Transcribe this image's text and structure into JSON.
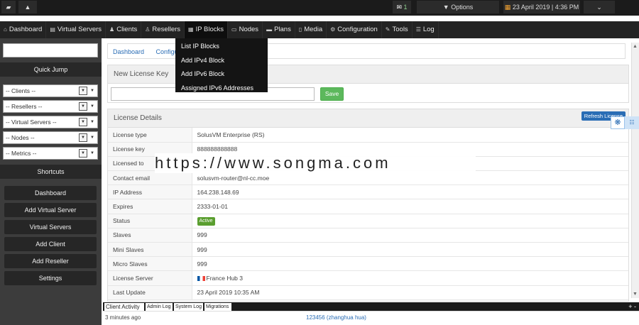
{
  "topbar": {
    "note_icon": "note-icon",
    "alert_icon": "warning-icon",
    "messages_count": "1",
    "options_label": "Options",
    "date_label": "23 April 2019 | 4:36 PM"
  },
  "nav": [
    {
      "label": "Dashboard",
      "icon": "home-icon",
      "glyph": "⌂"
    },
    {
      "label": "Virtual Servers",
      "icon": "server-icon",
      "glyph": "▤"
    },
    {
      "label": "Clients",
      "icon": "users-icon",
      "glyph": "♟"
    },
    {
      "label": "Resellers",
      "icon": "user-icon",
      "glyph": "♙"
    },
    {
      "label": "IP Blocks",
      "icon": "grid-icon",
      "glyph": "▦"
    },
    {
      "label": "Nodes",
      "icon": "node-icon",
      "glyph": "▭"
    },
    {
      "label": "Plans",
      "icon": "plans-icon",
      "glyph": "▬"
    },
    {
      "label": "Media",
      "icon": "media-icon",
      "glyph": "▯"
    },
    {
      "label": "Configuration",
      "icon": "gear-icon",
      "glyph": "⚙"
    },
    {
      "label": "Tools",
      "icon": "wrench-icon",
      "glyph": "✎"
    },
    {
      "label": "Log",
      "icon": "list-icon",
      "glyph": "☰"
    }
  ],
  "ip_dropdown": [
    "List IP Blocks",
    "Add IPv4 Block",
    "Add IPv6 Block",
    "Assigned IPv6 Addresses"
  ],
  "sidebar": {
    "quick_jump": "Quick Jump",
    "selects": [
      "-- Clients --",
      "-- Resellers --",
      "-- Virtual Servers --",
      "-- Nodes --",
      "-- Metrics --"
    ],
    "shortcuts_header": "Shortcuts",
    "shortcuts": [
      "Dashboard",
      "Add Virtual Server",
      "Virtual Servers",
      "Add Client",
      "Add Reseller",
      "Settings"
    ]
  },
  "breadcrumb": [
    "Dashboard",
    "Configu"
  ],
  "new_key": {
    "title": "New License Key",
    "save_label": "Save"
  },
  "details": {
    "title": "License Details",
    "refresh_label": "Refresh License",
    "rows": [
      {
        "key": "License type",
        "value": "SolusVM Enterprise (RS)"
      },
      {
        "key": "License key",
        "value": "888888888888"
      },
      {
        "key": "Licensed to",
        "value": ""
      },
      {
        "key": "Contact email",
        "value": "solusvm-router@nl-cc.moe"
      },
      {
        "key": "IP Address",
        "value": "164.238.148.69"
      },
      {
        "key": "Expires",
        "value": "2333-01-01"
      },
      {
        "key": "Status",
        "value": "Active"
      },
      {
        "key": "Slaves",
        "value": "999"
      },
      {
        "key": "Mini Slaves",
        "value": "999"
      },
      {
        "key": "Micro Slaves",
        "value": "999"
      },
      {
        "key": "License Server",
        "value": "France Hub 3"
      },
      {
        "key": "Last Update",
        "value": "23 April 2019 10:35 AM"
      }
    ]
  },
  "watermark": "https://www.songma.com",
  "activity": {
    "tabs": [
      "Client Activity",
      "Admin Log",
      "System Log",
      "Migrations"
    ],
    "controls": "+ -",
    "row": {
      "time": "3 minutes ago",
      "who": "123456 (zhanghua hua)"
    }
  }
}
